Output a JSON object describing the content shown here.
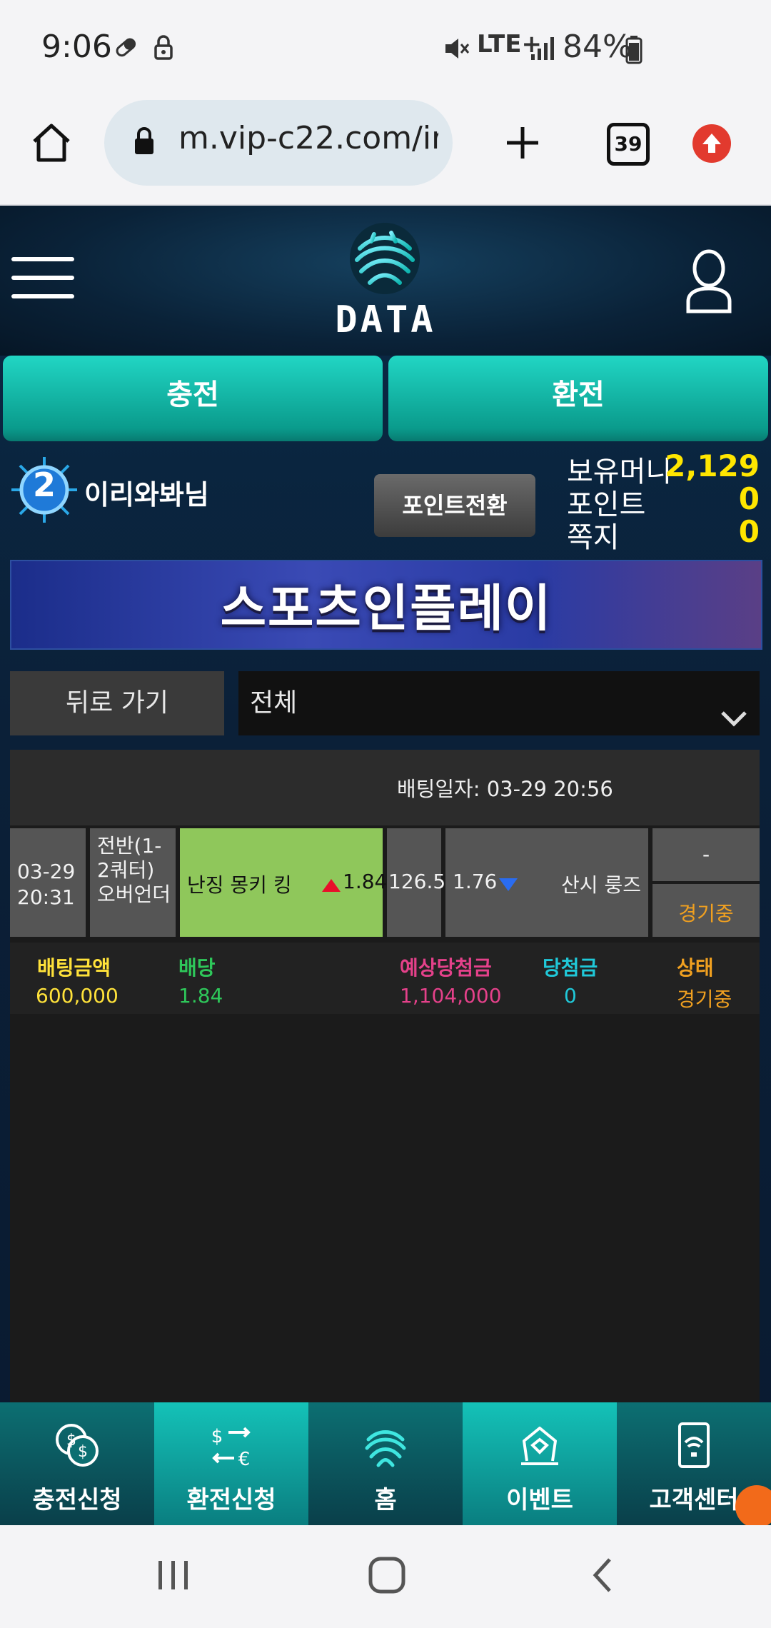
{
  "status_bar": {
    "time": "9:06",
    "battery": "84%",
    "network": "LTE+"
  },
  "browser": {
    "url": "m.vip-c22.com/ir",
    "tab_count": "39"
  },
  "site": {
    "logo_text": "DATA",
    "charge_button": "충전",
    "exchange_button": "환전",
    "user": {
      "level": "2",
      "name": "이리와봐님",
      "point_convert_button": "포인트전환",
      "balance_label": "보유머니",
      "balance_value": "2,129",
      "point_label": "포인트",
      "point_value": "0",
      "message_label": "쪽지",
      "message_value": "0"
    },
    "banner_title": "스포츠인플레이",
    "back_button": "뒤로 가기",
    "filter_select": "전체",
    "bet": {
      "bet_date_label": "배팅일자: 03-29 20:56",
      "game_date": "03-29",
      "game_time": "20:31",
      "market": "전반(1-2쿼터) 오버언더",
      "home_team": "난징 몽키 킹",
      "home_odds": "1.84",
      "line": "126.5",
      "away_odds": "1.76",
      "away_team": "산시 룽즈",
      "result": "-",
      "status": "경기중"
    },
    "summary": {
      "headers": [
        "배팅금액",
        "배당",
        "예상당첨금",
        "당첨금",
        "상태"
      ],
      "values": [
        "600,000",
        "1.84",
        "1,104,000",
        "0",
        "경기중"
      ],
      "colors": [
        "#ffe23a",
        "#2ec75a",
        "#e4418a",
        "#20c8d8",
        "#f0a020"
      ]
    },
    "bottom_nav": [
      {
        "label": "충전신청",
        "icon": "coins-icon"
      },
      {
        "label": "환전신청",
        "icon": "currency-exchange-icon"
      },
      {
        "label": "홈",
        "icon": "home-logo-icon"
      },
      {
        "label": "이벤트",
        "icon": "gift-icon"
      },
      {
        "label": "고객센터",
        "icon": "phone-support-icon"
      }
    ]
  }
}
